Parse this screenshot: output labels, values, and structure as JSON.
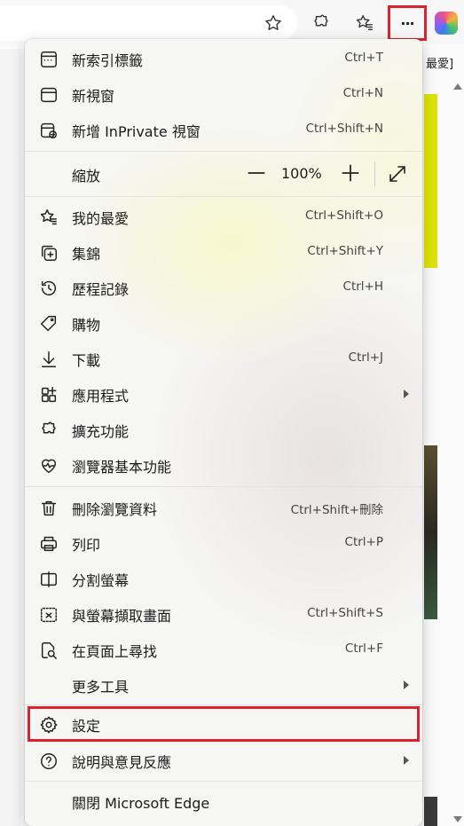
{
  "toolbar": {
    "favorite_icon": "star-icon",
    "extensions_icon": "puzzle-icon",
    "favorites_icon": "star-list-icon",
    "more_label": "···",
    "copilot_icon": "copilot-icon"
  },
  "background": {
    "favorites_crumb": "最愛]"
  },
  "menu": {
    "items": [
      {
        "label": "新索引標籤",
        "shortcut": "Ctrl+T",
        "icon": "new-tab-icon"
      },
      {
        "label": "新視窗",
        "shortcut": "Ctrl+N",
        "icon": "new-window-icon"
      },
      {
        "label": "新增 InPrivate 視窗",
        "shortcut": "Ctrl+Shift+N",
        "icon": "inprivate-icon"
      },
      {
        "label": "縮放",
        "zoom_value": "100%",
        "icon": "zoom-icon"
      },
      {
        "label": "我的最愛",
        "shortcut": "Ctrl+Shift+O",
        "icon": "favorites-icon"
      },
      {
        "label": "集錦",
        "shortcut": "Ctrl+Shift+Y",
        "icon": "collections-icon"
      },
      {
        "label": "歷程記錄",
        "shortcut": "Ctrl+H",
        "icon": "history-icon"
      },
      {
        "label": "購物",
        "shortcut": "",
        "icon": "shopping-tag-icon"
      },
      {
        "label": "下載",
        "shortcut": "Ctrl+J",
        "icon": "download-icon"
      },
      {
        "label": "應用程式",
        "shortcut": "",
        "icon": "apps-icon",
        "submenu": true
      },
      {
        "label": "擴充功能",
        "shortcut": "",
        "icon": "extensions-icon"
      },
      {
        "label": "瀏覽器基本功能",
        "shortcut": "",
        "icon": "heartbeat-icon"
      },
      {
        "label": "刪除瀏覽資料",
        "shortcut": "Ctrl+Shift+刪除",
        "icon": "trash-icon"
      },
      {
        "label": "列印",
        "shortcut": "Ctrl+P",
        "icon": "print-icon"
      },
      {
        "label": "分割螢幕",
        "shortcut": "",
        "icon": "split-screen-icon"
      },
      {
        "label": "與螢幕擷取畫面",
        "shortcut": "Ctrl+Shift+S",
        "icon": "screenshot-icon"
      },
      {
        "label": "在頁面上尋找",
        "shortcut": "Ctrl+F",
        "icon": "find-icon"
      },
      {
        "label": "更多工具",
        "shortcut": "",
        "icon": "",
        "submenu": true
      },
      {
        "label": "設定",
        "shortcut": "",
        "icon": "gear-icon",
        "highlighted": true
      },
      {
        "label": "說明與意見反應",
        "shortcut": "",
        "icon": "help-icon",
        "submenu": true
      },
      {
        "label": "關閉 Microsoft Edge",
        "shortcut": "",
        "icon": ""
      }
    ]
  },
  "colors": {
    "highlight": "#d9232d",
    "yellow_card": "#dde300"
  }
}
